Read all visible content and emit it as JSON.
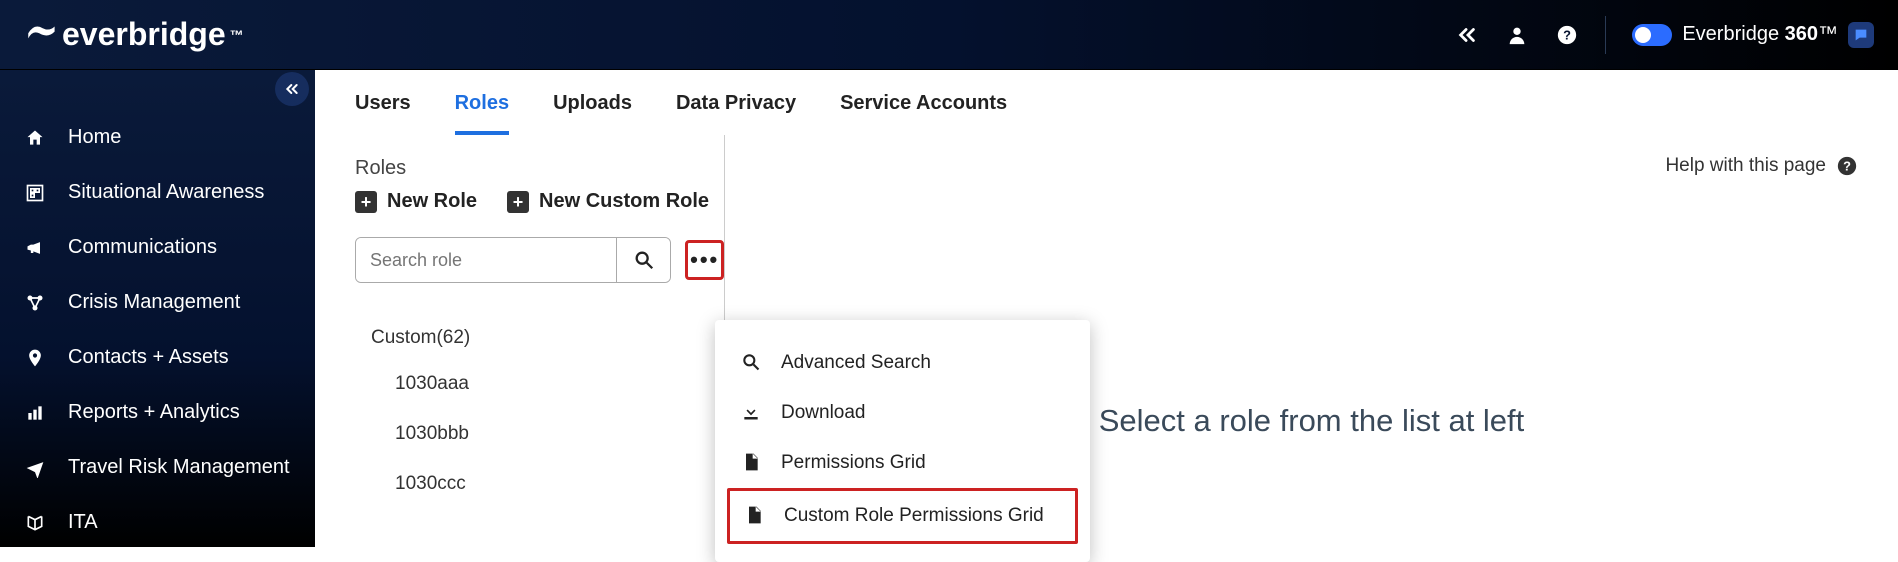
{
  "header": {
    "brand": "everbridge",
    "brand360_prefix": "Everbridge ",
    "brand360_bold": "360",
    "brand360_suffix": "™"
  },
  "sidebar": {
    "items": [
      {
        "label": "Home"
      },
      {
        "label": "Situational Awareness"
      },
      {
        "label": "Communications"
      },
      {
        "label": "Crisis Management"
      },
      {
        "label": "Contacts + Assets"
      },
      {
        "label": "Reports + Analytics"
      },
      {
        "label": "Travel Risk Management"
      },
      {
        "label": "ITA"
      }
    ]
  },
  "tabs": [
    {
      "label": "Users"
    },
    {
      "label": "Roles"
    },
    {
      "label": "Uploads"
    },
    {
      "label": "Data Privacy"
    },
    {
      "label": "Service Accounts"
    }
  ],
  "roles": {
    "title": "Roles",
    "new_role": "New Role",
    "new_custom_role": "New Custom Role",
    "search_placeholder": "Search role",
    "group_label": "Custom(62)",
    "items": [
      {
        "label": "1030aaa"
      },
      {
        "label": "1030bbb"
      },
      {
        "label": "1030ccc"
      }
    ]
  },
  "menu": {
    "advanced_search": "Advanced Search",
    "download": "Download",
    "permissions_grid": "Permissions Grid",
    "custom_permissions_grid": "Custom Role Permissions Grid"
  },
  "right": {
    "help": "Help with this page",
    "empty_msg": "Select a role from the list at left"
  }
}
